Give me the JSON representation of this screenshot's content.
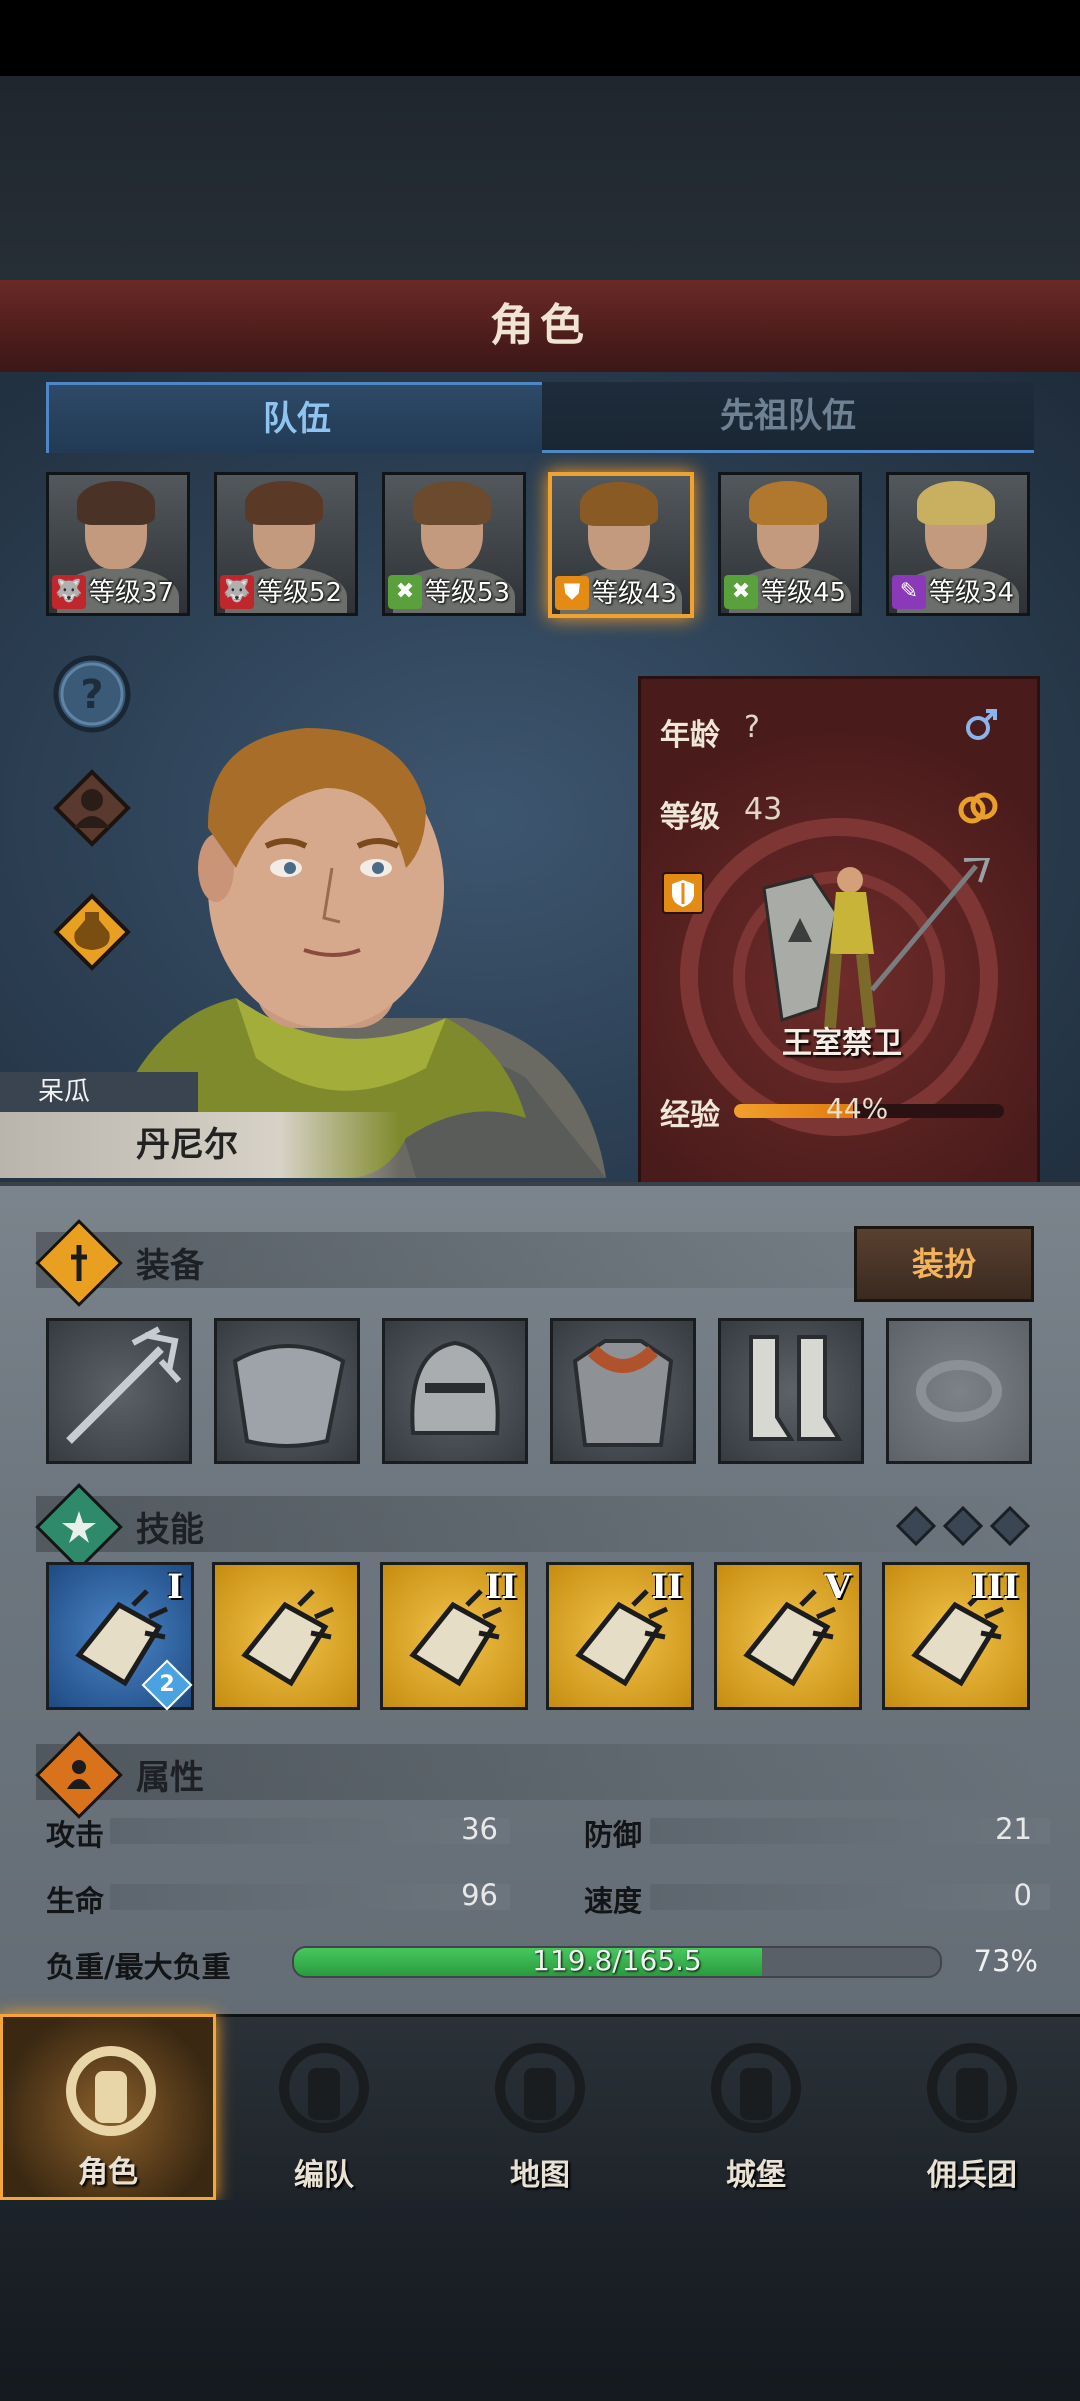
{
  "header": {
    "title": "角色"
  },
  "tabs": [
    {
      "label": "队伍",
      "active": true
    },
    {
      "label": "先祖队伍",
      "active": false
    }
  ],
  "roster": [
    {
      "level_text": "等级37",
      "class_icon": "wolf-icon",
      "class_color": "#c0272d",
      "hair": "#4a3326"
    },
    {
      "level_text": "等级52",
      "class_icon": "wolf-icon",
      "class_color": "#c0272d",
      "hair": "#5a3a26"
    },
    {
      "level_text": "等级53",
      "class_icon": "crossed-swords-icon",
      "class_color": "#5aa03c",
      "hair": "#6b4a2e"
    },
    {
      "level_text": "等级43",
      "class_icon": "shield-icon",
      "class_color": "#e38b12",
      "hair": "#8a5a24",
      "selected": true
    },
    {
      "level_text": "等级45",
      "class_icon": "crossed-swords-icon",
      "class_color": "#5aa03c",
      "hair": "#b0782e"
    },
    {
      "level_text": "等级34",
      "class_icon": "staff-icon",
      "class_color": "#8a3ab8",
      "hair": "#c9b060"
    }
  ],
  "hero": {
    "trait": "呆瓜",
    "name": "丹尼尔"
  },
  "info_card": {
    "age_label": "年龄",
    "age_value": "?",
    "level_label": "等级",
    "level_value": "43",
    "class_name": "王室禁卫",
    "exp_label": "经验",
    "exp_text": "44%",
    "exp_fraction": 0.44
  },
  "equipment": {
    "title": "装备",
    "outfit_button": "装扮",
    "slots": [
      "trident-icon",
      "shoulder-armor-icon",
      "helmet-icon",
      "body-armor-icon",
      "boots-icon",
      "ring-slot-empty-icon"
    ]
  },
  "skills": {
    "title": "技能",
    "items": [
      {
        "icon": "fist-strike-icon",
        "rank": "I",
        "badge": "2",
        "style": "blue"
      },
      {
        "icon": "heal-strike-icon",
        "rank": "",
        "badge": "",
        "style": "gold"
      },
      {
        "icon": "precise-thrust-icon",
        "rank": "II",
        "badge": "",
        "style": "gold"
      },
      {
        "icon": "shield-bash-icon",
        "rank": "II",
        "badge": "",
        "style": "gold"
      },
      {
        "icon": "shield-block-icon",
        "rank": "V",
        "badge": "",
        "style": "gold"
      },
      {
        "icon": "shield-slam-icon",
        "rank": "III",
        "badge": "",
        "style": "gold"
      }
    ]
  },
  "attributes": {
    "title": "属性",
    "attack_label": "攻击",
    "attack_value": "36",
    "defense_label": "防御",
    "defense_value": "21",
    "hp_label": "生命",
    "hp_value": "96",
    "speed_label": "速度",
    "speed_value": "0",
    "load_label": "负重/最大负重",
    "load_text": "119.8/165.5",
    "load_percent": "73%",
    "load_fraction": 0.724
  },
  "nav": [
    {
      "label": "角色",
      "icon": "knight-icon",
      "active": true
    },
    {
      "label": "编队",
      "icon": "helmet-flag-icon",
      "active": false
    },
    {
      "label": "地图",
      "icon": "compass-map-icon",
      "active": false
    },
    {
      "label": "城堡",
      "icon": "castle-icon",
      "active": false
    },
    {
      "label": "佣兵团",
      "icon": "banner-fist-icon",
      "active": false
    }
  ],
  "colors": {
    "accent_orange": "#f3a63a",
    "tab_blue": "#4f87c4",
    "exp_orange": "#f0a02c",
    "load_green": "#37b24d"
  }
}
